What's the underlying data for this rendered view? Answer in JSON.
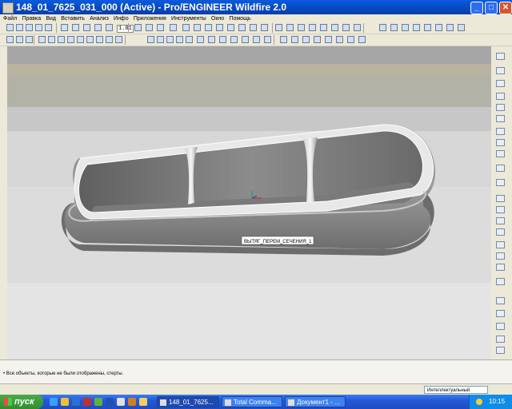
{
  "window": {
    "title": "148_01_7625_031_000 (Active) - Pro/ENGINEER Wildfire 2.0",
    "controls": [
      "_",
      "□",
      "✕"
    ]
  },
  "menu": [
    "Файл",
    "Правка",
    "Вид",
    "Вставить",
    "Анализ",
    "Инфо",
    "Приложения",
    "Инструменты",
    "Окно",
    "Помощь"
  ],
  "toolbar": {
    "scale_value": "1.01"
  },
  "viewport": {
    "background_colors": [
      "#a6a6a6",
      "#b8b4a0",
      "#b3b2a6",
      "#c7c7c7",
      "#d7d7d7",
      "#dcdcdc",
      "#e4e4e4"
    ],
    "feature_label": "ВЫТЯГ_ПЕРЕМ_СЕЧЕНИЯ_1"
  },
  "messages": {
    "line": "• Все объекты, которые не были отображены, стерты."
  },
  "status": {
    "filter": "Интеллектуальный"
  },
  "taskbar": {
    "start": "пуск",
    "tasks": [
      "148_01_7625...",
      "Total Comma...",
      "Документ1 - ..."
    ],
    "clock": "10:15"
  }
}
